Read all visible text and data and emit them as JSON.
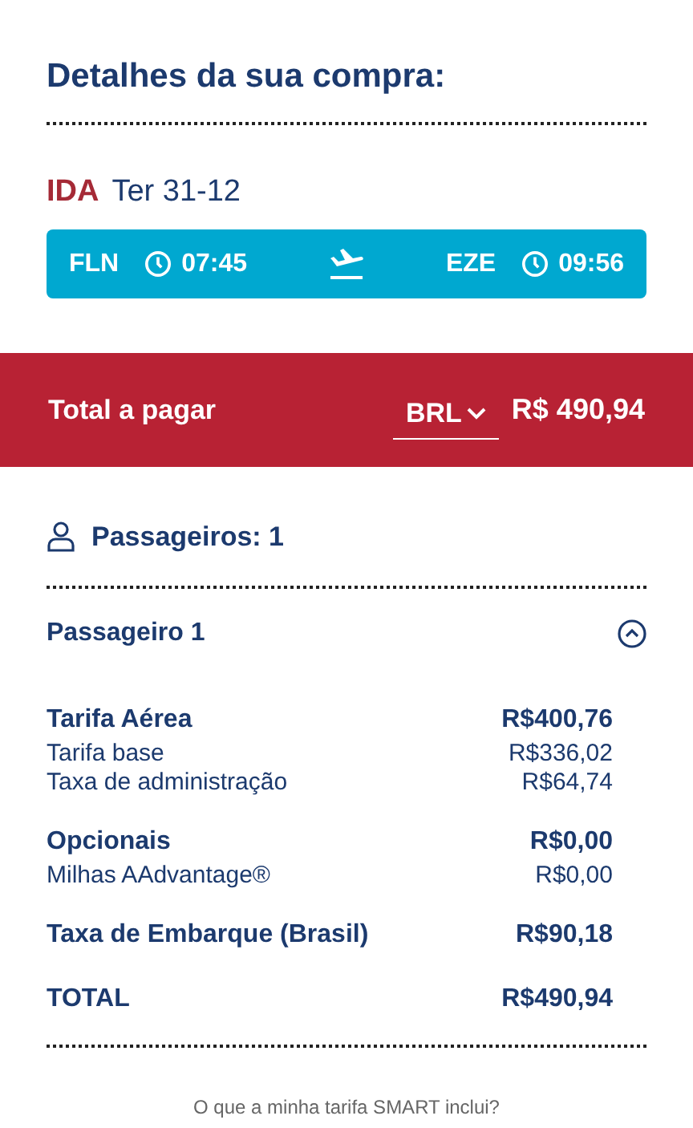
{
  "title": "Detalhes da sua compra:",
  "flight": {
    "direction": "IDA",
    "date": "Ter 31-12",
    "origin": "FLN",
    "departure": "07:45",
    "destination": "EZE",
    "arrival": "09:56"
  },
  "total_bar": {
    "label": "Total a pagar",
    "currency": "BRL",
    "amount": "R$ 490,94"
  },
  "passengers": {
    "label": "Passageiros: 1"
  },
  "passenger": {
    "name": "Passageiro 1",
    "expanded": true,
    "groups": [
      {
        "label": "Tarifa Aérea",
        "amount": "R$400,76",
        "items": [
          {
            "label": "Tarifa base",
            "amount": "R$336,02"
          },
          {
            "label": "Taxa de administração",
            "amount": "R$64,74"
          }
        ]
      },
      {
        "label": "Opcionais",
        "amount": "R$0,00",
        "items": [
          {
            "label": "Milhas AAdvantage®",
            "amount": "R$0,00"
          }
        ]
      },
      {
        "label": "Taxa de Embarque (Brasil)",
        "amount": "R$90,18"
      },
      {
        "label": "TOTAL",
        "amount": "R$490,94"
      }
    ]
  },
  "fare_link": "O que a minha tarifa SMART inclui?"
}
